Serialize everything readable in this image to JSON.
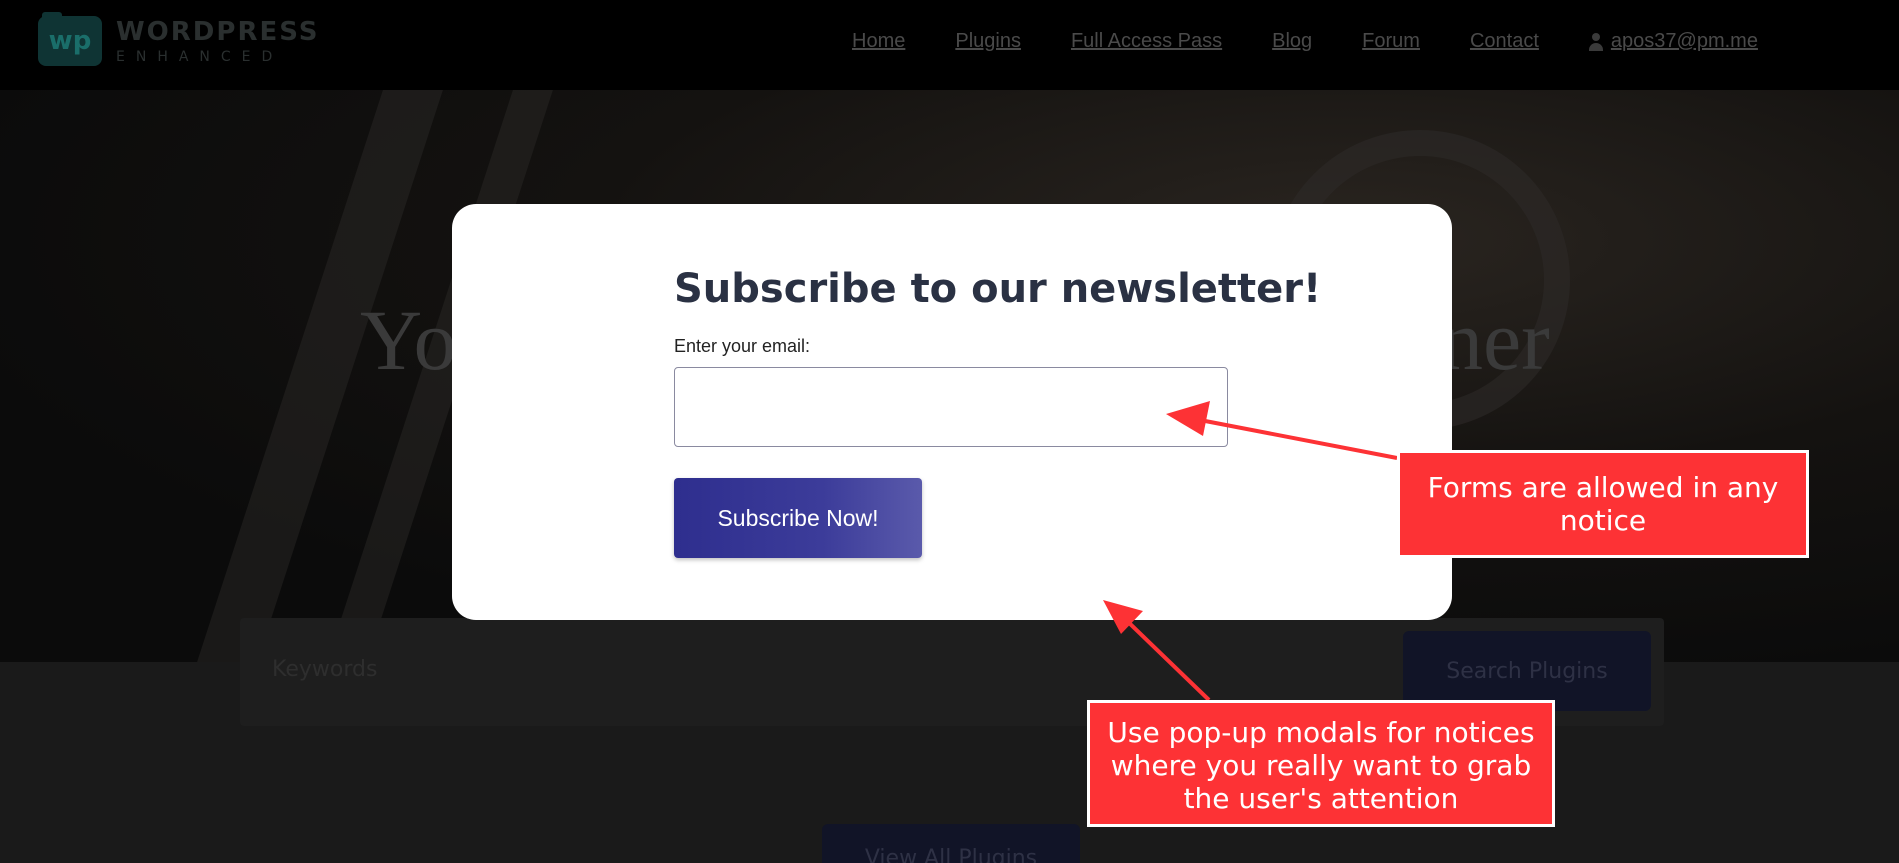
{
  "header": {
    "logo_line1": "WORDPRESS",
    "logo_line2": "ENHANCED",
    "logo_mark": "wp",
    "nav": [
      {
        "label": "Home"
      },
      {
        "label": "Plugins"
      },
      {
        "label": "Full Access Pass"
      },
      {
        "label": "Blog"
      },
      {
        "label": "Forum"
      },
      {
        "label": "Contact"
      }
    ],
    "account_email": "apos37@pm.me"
  },
  "hero": {
    "title_left": "Yo",
    "title_right": "ner"
  },
  "search": {
    "placeholder": "Keywords",
    "button_label": "Search Plugins"
  },
  "view_all_label": "View All Plugins",
  "modal": {
    "title": "Subscribe to our newsletter!",
    "email_label": "Enter your email:",
    "email_value": "",
    "submit_label": "Subscribe Now!"
  },
  "annotations": {
    "forms_note": "Forms are allowed in any notice",
    "modal_note": "Use pop-up modals for notices where you really want to grab the user's attention",
    "color": "#fd3235"
  },
  "colors": {
    "button_gradient_start": "#2e2e8e",
    "button_gradient_end": "#5a5aab",
    "title_color": "#2a3143"
  }
}
